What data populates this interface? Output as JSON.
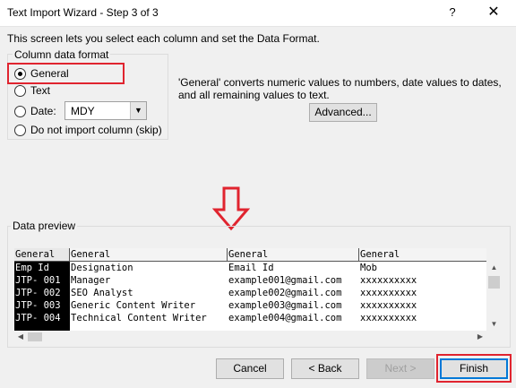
{
  "window": {
    "title": "Text Import Wizard - Step 3 of 3",
    "help": "?",
    "close": "✕"
  },
  "intro": "This screen lets you select each column and set the Data Format.",
  "format": {
    "legend": "Column data format",
    "general": "General",
    "text": "Text",
    "date": "Date:",
    "date_value": "MDY",
    "skip": "Do not import column (skip)",
    "selected": "general"
  },
  "description": "'General' converts numeric values to numbers, date values to dates, and all remaining values to text.",
  "advanced_label": "Advanced...",
  "preview": {
    "legend": "Data preview",
    "columns": [
      {
        "header": "General",
        "cells": [
          "Emp Id",
          "JTP- 001",
          "JTP- 002",
          "JTP- 003",
          "JTP- 004"
        ]
      },
      {
        "header": "General",
        "cells": [
          "Designation",
          "Manager",
          "SEO Analyst",
          "Generic Content Writer",
          "Technical Content Writer"
        ]
      },
      {
        "header": "General",
        "cells": [
          "Email Id",
          "example001@gmail.com",
          "example002@gmail.com",
          "example003@gmail.com",
          "example004@gmail.com"
        ]
      },
      {
        "header": "General",
        "cells": [
          "Mob",
          "xxxxxxxxxx",
          "xxxxxxxxxx",
          "xxxxxxxxxx",
          "xxxxxxxxxx"
        ]
      }
    ]
  },
  "buttons": {
    "cancel": "Cancel",
    "back": "< Back",
    "next": "Next >",
    "finish": "Finish"
  },
  "colors": {
    "highlight": "#e0242f",
    "accent": "#0078d7"
  }
}
